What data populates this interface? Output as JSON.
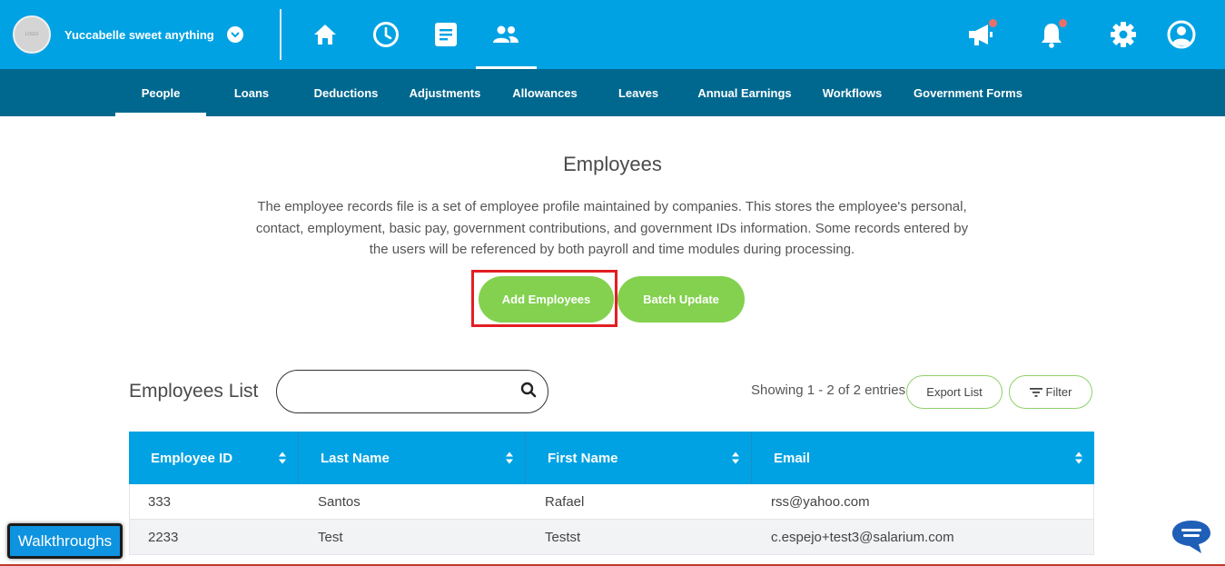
{
  "topbar": {
    "company_name": "Yuccabelle sweet anything",
    "avatar_text": "LOGO",
    "colors": {
      "primary": "#00a2e3",
      "notification_dot": "#e8706b"
    },
    "icons": [
      "home-icon",
      "clock-icon",
      "document-icon",
      "people-icon",
      "megaphone-icon",
      "bell-icon",
      "gear-icon",
      "user-icon"
    ]
  },
  "subnav": {
    "items": [
      {
        "label": "People"
      },
      {
        "label": "Loans"
      },
      {
        "label": "Deductions"
      },
      {
        "label": "Adjustments"
      },
      {
        "label": "Allowances"
      },
      {
        "label": "Leaves"
      },
      {
        "label": "Annual Earnings"
      },
      {
        "label": "Workflows"
      },
      {
        "label": "Government Forms"
      }
    ],
    "active": "People",
    "color": "#00688f"
  },
  "main": {
    "title": "Employees",
    "description": "The employee records file is a set of employee profile maintained by companies. This stores the employee's personal, contact, employment, basic pay, government contributions, and government IDs information. Some records entered by the users will be referenced by both payroll and time modules during processing.",
    "add_button": "Add Employees",
    "batch_button": "Batch Update",
    "button_color": "#83d14f"
  },
  "list": {
    "title": "Employees List",
    "search_value": "",
    "showing": "Showing 1 - 2 of 2 entries",
    "export_button": "Export List",
    "filter_button": "Filter",
    "columns": [
      "Employee ID",
      "Last Name",
      "First Name",
      "Email"
    ],
    "rows": [
      [
        "333",
        "Santos",
        "Rafael",
        "rss@yahoo.com"
      ],
      [
        "2233",
        "Test",
        "Testst",
        "c.espejo+test3@salarium.com"
      ]
    ]
  },
  "walkthroughs_button": "Walkthroughs"
}
